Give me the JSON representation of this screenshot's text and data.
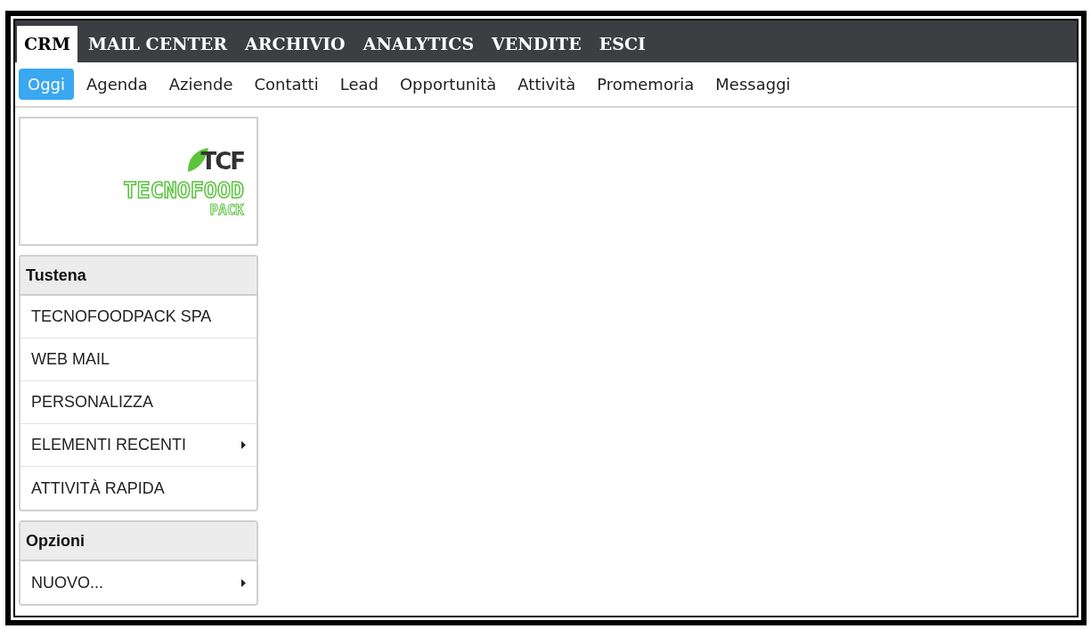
{
  "top_menu": [
    {
      "label": "CRM",
      "selected": true
    },
    {
      "label": "MAIL CENTER",
      "selected": false
    },
    {
      "label": "ARCHIVIO",
      "selected": false
    },
    {
      "label": "ANALYTICS",
      "selected": false
    },
    {
      "label": "VENDITE",
      "selected": false
    },
    {
      "label": "ESCI",
      "selected": false
    }
  ],
  "sub_menu": [
    {
      "label": "Oggi",
      "selected": true
    },
    {
      "label": "Agenda",
      "selected": false
    },
    {
      "label": "Aziende",
      "selected": false
    },
    {
      "label": "Contatti",
      "selected": false
    },
    {
      "label": "Lead",
      "selected": false
    },
    {
      "label": "Opportunità",
      "selected": false
    },
    {
      "label": "Attività",
      "selected": false
    },
    {
      "label": "Promemoria",
      "selected": false
    },
    {
      "label": "Messaggi",
      "selected": false
    }
  ],
  "logo": {
    "mark": "TCF",
    "name": "TECNOFOOD",
    "sub": "PACK"
  },
  "sidebar": [
    {
      "title": "Tustena",
      "items": [
        {
          "label": "TECNOFOODPACK SPA",
          "submenu": false
        },
        {
          "label": "WEB MAIL",
          "submenu": false
        },
        {
          "label": "PERSONALIZZA",
          "submenu": false
        },
        {
          "label": "ELEMENTI RECENTI",
          "submenu": true
        },
        {
          "label": "ATTIVITÀ RAPIDA",
          "submenu": false
        }
      ]
    },
    {
      "title": "Opzioni",
      "items": [
        {
          "label": "NUOVO...",
          "submenu": true
        }
      ]
    }
  ]
}
